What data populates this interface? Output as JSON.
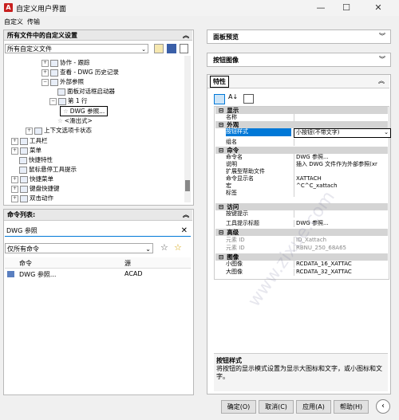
{
  "window": {
    "title": "自定义用户界面",
    "app_icon": "A"
  },
  "menu": [
    "自定义",
    "传输"
  ],
  "left_panel": {
    "header": "所有文件中的自定义设置",
    "file_combo": "所有自定义文件",
    "tree": [
      {
        "label": "协作 - 跟踪"
      },
      {
        "label": "查看 - DWG 历史记录"
      },
      {
        "label": "外部参照"
      },
      {
        "label": "面板对话框启动器"
      },
      {
        "label": "第 1 行"
      },
      {
        "label": "DWG 参照..."
      },
      {
        "label": "<滑出式>"
      },
      {
        "label": "上下文选项卡状态"
      },
      {
        "label": "工具栏"
      },
      {
        "label": "菜单"
      },
      {
        "label": "快捷特性"
      },
      {
        "label": "鼠标悬停工具提示"
      },
      {
        "label": "快捷菜单"
      },
      {
        "label": "键盘快捷键"
      },
      {
        "label": "双击动作"
      }
    ]
  },
  "command_list": {
    "header": "命令列表:",
    "search_value": "DWG 参照",
    "filter_combo": "仅所有命令",
    "columns": [
      "命令",
      "源"
    ],
    "rows": [
      {
        "command": "DWG 参照...",
        "source": "ACAD"
      }
    ]
  },
  "right_panel": {
    "panel_preview": "面板预览",
    "button_image": "按钮图像",
    "properties": "特性",
    "groups": [
      {
        "name": "显示",
        "rows": [
          {
            "n": "名称",
            "v": ""
          }
        ]
      },
      {
        "name": "外观",
        "rows": [
          {
            "n": "按钮样式",
            "v": "小按钮(不带文字)"
          },
          {
            "n": "组名",
            "v": ""
          }
        ]
      },
      {
        "name": "命令",
        "rows": [
          {
            "n": "命令名",
            "v": "DWG 参照..."
          },
          {
            "n": "说明",
            "v": "插入 DWG 文件作为外部参照(xr"
          },
          {
            "n": "扩展型帮助文件",
            "v": ""
          },
          {
            "n": "命令显示名",
            "v": "XATTACH"
          },
          {
            "n": "宏",
            "v": "^C^C_xattach"
          },
          {
            "n": "标签",
            "v": ""
          }
        ]
      },
      {
        "name": "访问",
        "rows": [
          {
            "n": "按键提示",
            "v": ""
          },
          {
            "n": "工具提示标题",
            "v": "DWG 参照..."
          }
        ]
      },
      {
        "name": "高级",
        "rows": [
          {
            "n": "元素 ID",
            "v": "ID_Xattach"
          },
          {
            "n": "元素 ID",
            "v": "RBNU_250_68A65"
          }
        ]
      },
      {
        "name": "图像",
        "rows": [
          {
            "n": "小图像",
            "v": "RCDATA_16_XATTAC"
          },
          {
            "n": "大图像",
            "v": "RCDATA_32_XATTAC"
          }
        ]
      }
    ],
    "desc_title": "按钮样式",
    "desc_text": "将按钮的显示模式设置为显示大图标和文字，或小图标和文字。"
  },
  "buttons": {
    "ok": "确定(O)",
    "cancel": "取消(C)",
    "apply": "应用(A)",
    "help": "帮助(H)"
  },
  "colors": {
    "selection": "#0078d7",
    "highlight_box": "#000000",
    "category": "#d4d4d4"
  }
}
